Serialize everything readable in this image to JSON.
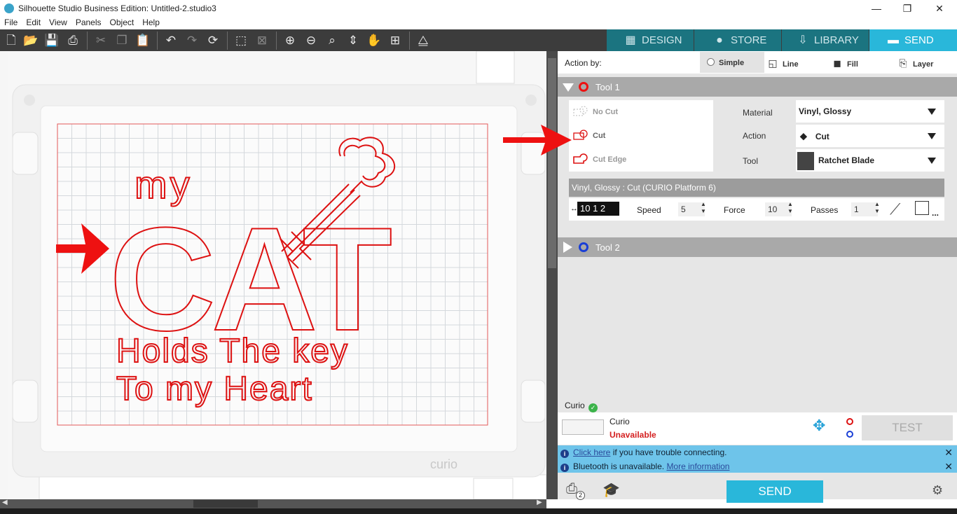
{
  "window": {
    "title": "Silhouette Studio Business Edition: Untitled-2.studio3",
    "minimize": "—",
    "restore": "❐",
    "close": "✕"
  },
  "menu": [
    "File",
    "Edit",
    "View",
    "Panels",
    "Object",
    "Help"
  ],
  "nav_tabs": [
    {
      "label": "DESIGN",
      "icon": "grid-icon"
    },
    {
      "label": "STORE",
      "icon": "silhouette-s-icon"
    },
    {
      "label": "LIBRARY",
      "icon": "download-icon"
    },
    {
      "label": "SEND",
      "icon": "cutter-icon",
      "active": true
    }
  ],
  "canvas": {
    "text_line1": "my",
    "text_line2": "CAT",
    "text_line3": "Holds The key",
    "text_line4": "To my Heart",
    "machine_label": "curio",
    "accent_red": "#e01010"
  },
  "action_by": {
    "label": "Action by:",
    "tabs": [
      "Simple",
      "Line",
      "Fill",
      "Layer"
    ],
    "active": "Simple"
  },
  "tool1": {
    "name": "Tool 1",
    "options": [
      "No Cut",
      "Cut",
      "Cut Edge"
    ],
    "material_label": "Material",
    "material_value": "Vinyl, Glossy",
    "action_label": "Action",
    "action_value": "Cut",
    "tool_label": "Tool",
    "tool_value": "Ratchet Blade",
    "preset_header": "Vinyl, Glossy : Cut (CURIO Platform 6)",
    "blade_display": "10 1 2",
    "speed_label": "Speed",
    "speed_value": "5",
    "force_label": "Force",
    "force_value": "10",
    "passes_label": "Passes",
    "passes_value": "1",
    "more": "..."
  },
  "tool2": {
    "name": "Tool 2"
  },
  "device": {
    "name_label": "Curio",
    "model": "Curio",
    "status": "Unavailable",
    "test_button": "TEST"
  },
  "info": [
    {
      "link": "Click here",
      "text": " if you have trouble connecting."
    },
    {
      "text": "Bluetooth is unavailable. ",
      "link": "More information"
    }
  ],
  "send_button": "SEND",
  "badge_count": "2"
}
